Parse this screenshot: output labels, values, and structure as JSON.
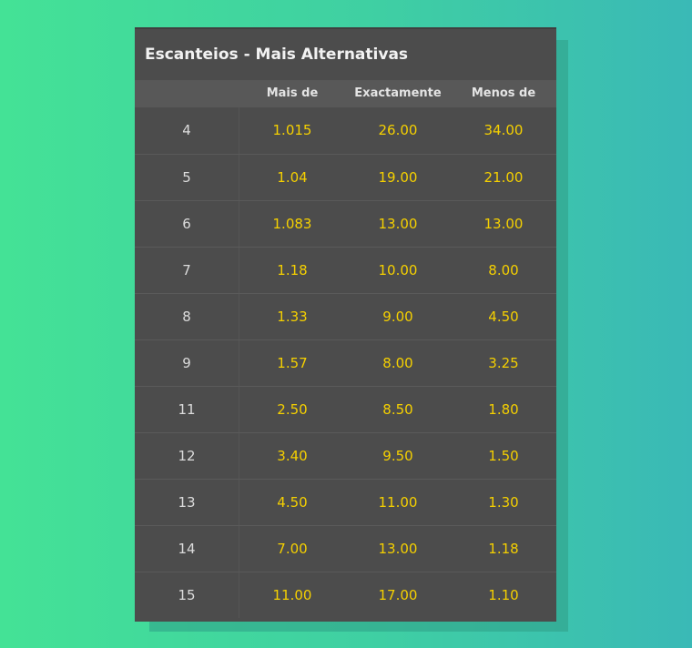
{
  "market": {
    "title": "Escanteios - Mais Alternativas",
    "headers": [
      "",
      "Mais de",
      "Exactamente",
      "Menos de"
    ],
    "rows": [
      {
        "line": "4",
        "over": "1.015",
        "exact": "26.00",
        "under": "34.00"
      },
      {
        "line": "5",
        "over": "1.04",
        "exact": "19.00",
        "under": "21.00"
      },
      {
        "line": "6",
        "over": "1.083",
        "exact": "13.00",
        "under": "13.00"
      },
      {
        "line": "7",
        "over": "1.18",
        "exact": "10.00",
        "under": "8.00"
      },
      {
        "line": "8",
        "over": "1.33",
        "exact": "9.00",
        "under": "4.50"
      },
      {
        "line": "9",
        "over": "1.57",
        "exact": "8.00",
        "under": "3.25"
      },
      {
        "line": "11",
        "over": "2.50",
        "exact": "8.50",
        "under": "1.80"
      },
      {
        "line": "12",
        "over": "3.40",
        "exact": "9.50",
        "under": "1.50"
      },
      {
        "line": "13",
        "over": "4.50",
        "exact": "11.00",
        "under": "1.30"
      },
      {
        "line": "14",
        "over": "7.00",
        "exact": "13.00",
        "under": "1.18"
      },
      {
        "line": "15",
        "over": "11.00",
        "exact": "17.00",
        "under": "1.10"
      }
    ]
  },
  "colors": {
    "odds": "#f5d000",
    "card_background": "#4c4c4c",
    "header_background": "#585858",
    "page_gradient_start": "#44e296",
    "page_gradient_end": "#3ab9b6"
  }
}
